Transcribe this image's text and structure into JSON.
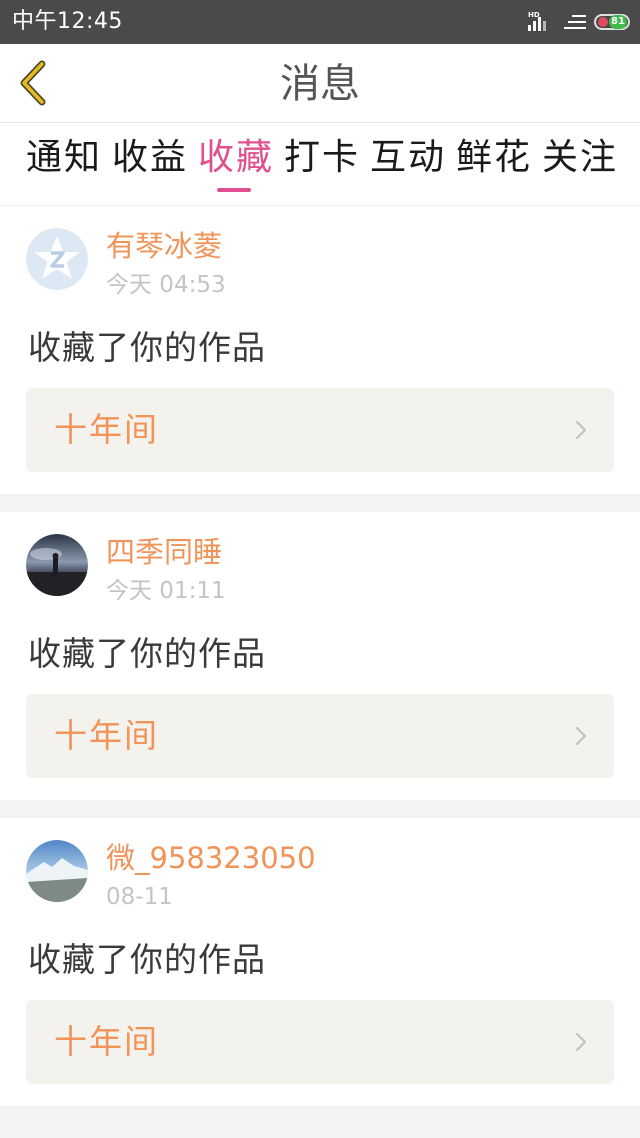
{
  "status_bar": {
    "time": "中午12:45",
    "network_label": "HD",
    "battery_level": "81"
  },
  "header": {
    "title": "消息"
  },
  "tabs": [
    {
      "label": "通知",
      "active": false
    },
    {
      "label": "收益",
      "active": false
    },
    {
      "label": "收藏",
      "active": true
    },
    {
      "label": "打卡",
      "active": false
    },
    {
      "label": "互动",
      "active": false
    },
    {
      "label": "鲜花",
      "active": false
    },
    {
      "label": "关注",
      "active": false
    }
  ],
  "messages": [
    {
      "user": "有琴冰菱",
      "time": "今天 04:53",
      "action": "收藏了你的作品",
      "work_title": "十年间"
    },
    {
      "user": "四季同睡",
      "time": "今天 01:11",
      "action": "收藏了你的作品",
      "work_title": "十年间"
    },
    {
      "user": "微_958323050",
      "time": "08-11",
      "action": "收藏了你的作品",
      "work_title": "十年间"
    }
  ],
  "colors": {
    "accent_pink": "#e0508e",
    "username_orange": "#f0945a",
    "back_arrow_yellow": "#e8b923",
    "work_box_bg": "#f4f2ec"
  }
}
